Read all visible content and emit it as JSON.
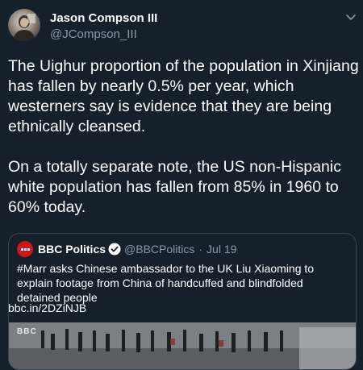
{
  "tweet": {
    "display_name": "Jason Compson III",
    "handle": "@JCompson_III",
    "paragraphs": [
      "The Uighur proportion of the population in Xinjiang has fallen by nearly 0.5% per year, which westerners say is evidence that they are being ethnically cleansed.",
      "On a totally separate note, the US non-Hispanic white population has fallen from 85% in 1960 to 60% today."
    ]
  },
  "quoted_tweet": {
    "name": "BBC Politics",
    "handle": "@BBCPolitics",
    "separator": "·",
    "date": "Jul 19",
    "text": "#Marr asks Chinese ambassador to the UK Liu Xiaoming to explain footage from China of handcuffed and blindfolded detained people",
    "link": "bbc.in/2DZiNJB",
    "image_watermark": "BBC"
  },
  "icons": {
    "menu": "chevron-down-icon",
    "verified": "verified-badge-icon"
  },
  "colors": {
    "background": "#15202b",
    "secondary_text": "#8899a6",
    "border": "#38444d",
    "verified": "#1da1f2",
    "bbc_red": "#d1151a"
  }
}
